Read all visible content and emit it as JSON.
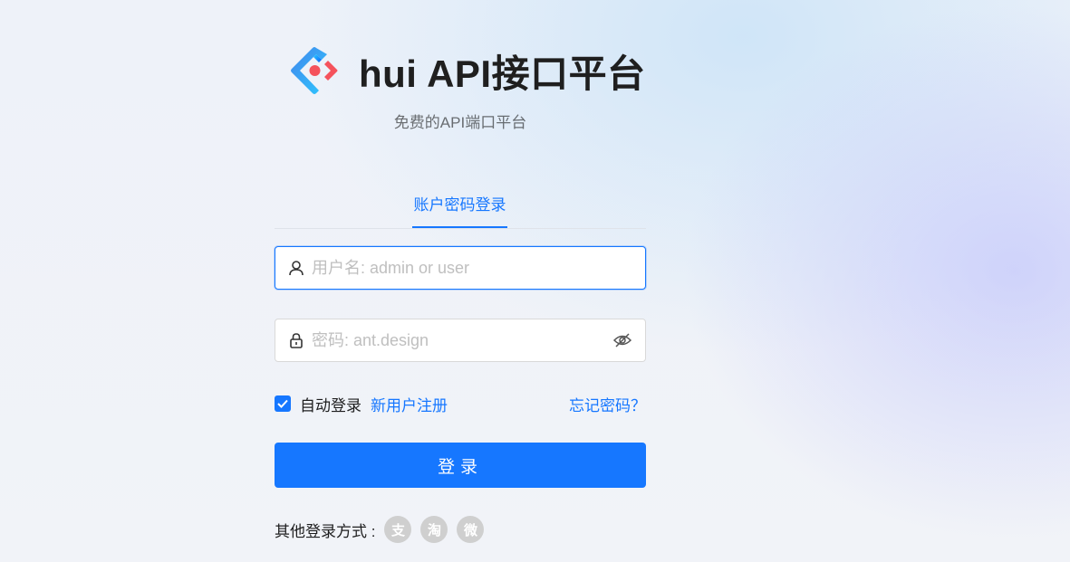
{
  "header": {
    "title": "hui API接口平台",
    "subtitle": "免费的API端口平台"
  },
  "tabs": [
    {
      "label": "账户密码登录",
      "active": true
    }
  ],
  "form": {
    "username": {
      "value": "",
      "placeholder": "用户名: admin or user",
      "icon": "user-icon"
    },
    "password": {
      "value": "",
      "placeholder": "密码: ant.design",
      "icon": "lock-icon",
      "toggle_icon": "eye-invisible-icon"
    },
    "auto_login": {
      "label": "自动登录",
      "checked": true
    },
    "register_link": "新用户注册",
    "forgot_link": "忘记密码？",
    "submit_label": "登录"
  },
  "other_login": {
    "label": "其他登录方式 :",
    "providers": [
      {
        "name": "alipay-icon",
        "glyph": "支"
      },
      {
        "name": "taobao-icon",
        "glyph": "淘"
      },
      {
        "name": "weibo-icon",
        "glyph": "微"
      }
    ]
  },
  "colors": {
    "primary": "#1677ff",
    "social_bg": "#cfcfcf"
  }
}
